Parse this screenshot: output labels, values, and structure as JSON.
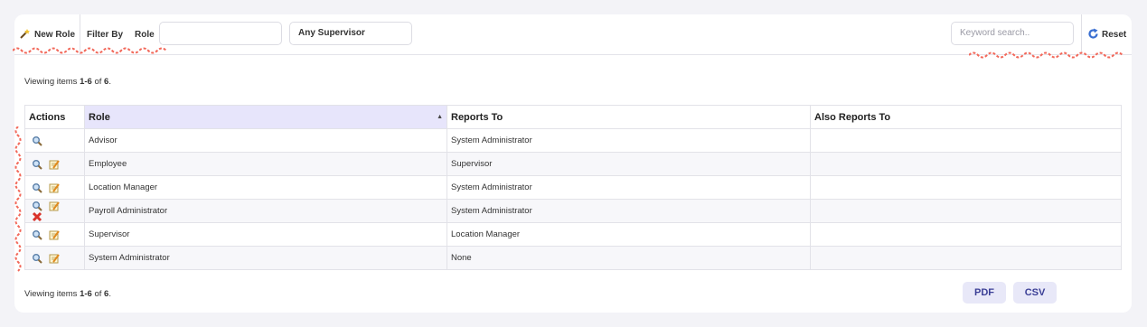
{
  "toolbar": {
    "new_role_label": "New Role",
    "filter_by_label": "Filter By",
    "role_label": "Role",
    "role_value": "",
    "supervisor_value": "Any Supervisor",
    "keyword_placeholder": "Keyword search..",
    "reset_label": "Reset"
  },
  "viewing": {
    "prefix": "Viewing items ",
    "range": "1-6",
    "of": " of ",
    "total": "6",
    "suffix": "."
  },
  "table": {
    "headers": [
      "Actions",
      "Role",
      "Reports To",
      "Also Reports To"
    ],
    "rows": [
      {
        "role": "Advisor",
        "reports_to": "System Administrator",
        "also": "",
        "actions": [
          "view"
        ]
      },
      {
        "role": "Employee",
        "reports_to": "Supervisor",
        "also": "",
        "actions": [
          "view",
          "edit"
        ]
      },
      {
        "role": "Location Manager",
        "reports_to": "System Administrator",
        "also": "",
        "actions": [
          "view",
          "edit"
        ]
      },
      {
        "role": "Payroll Administrator",
        "reports_to": "System Administrator",
        "also": "",
        "actions": [
          "view",
          "edit",
          "delete"
        ]
      },
      {
        "role": "Supervisor",
        "reports_to": "Location Manager",
        "also": "",
        "actions": [
          "view",
          "edit"
        ]
      },
      {
        "role": "System Administrator",
        "reports_to": "None",
        "also": "",
        "actions": [
          "view",
          "edit"
        ]
      }
    ]
  },
  "export": {
    "pdf_label": "PDF",
    "csv_label": "CSV"
  },
  "icons": {
    "new_role": "wand-icon",
    "reset": "refresh-icon",
    "view": "magnifier-icon",
    "edit": "edit-icon",
    "delete": "delete-icon",
    "sort": "sort-ascending-icon"
  },
  "colors": {
    "accent": "#3b3f96",
    "sorted_header": "#e7e5fb",
    "annotation": "#f2685a"
  }
}
